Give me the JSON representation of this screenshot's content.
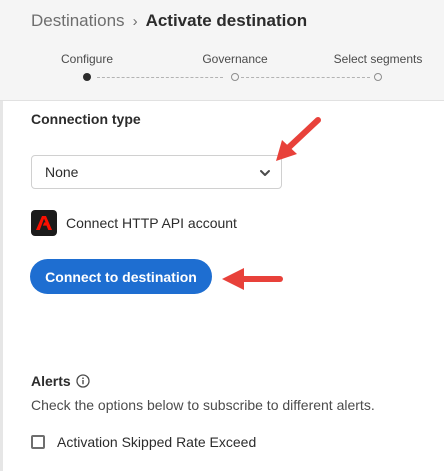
{
  "header": {
    "breadcrumb": {
      "parent": "Destinations",
      "separator": "›",
      "current": "Activate destination"
    },
    "steps": [
      {
        "label": "Configure",
        "state": "active"
      },
      {
        "label": "Governance",
        "state": "inactive"
      },
      {
        "label": "Select segments",
        "state": "inactive"
      }
    ]
  },
  "connection": {
    "title": "Connection type",
    "dropdown_value": "None",
    "dropdown_icon": "chevron-down-icon",
    "account_icon": "adobe-logo-icon",
    "account_label": "Connect HTTP API account",
    "connect_button": "Connect to destination"
  },
  "alerts": {
    "title": "Alerts",
    "info_icon": "info-icon",
    "description": "Check the options below to subscribe to different alerts.",
    "options": [
      {
        "label": "Activation Skipped Rate Exceed",
        "checked": false
      }
    ]
  },
  "colors": {
    "primary_button": "#1e6ed1",
    "annotation_arrow": "#e8413a",
    "header_background": "#f5f5f5"
  }
}
